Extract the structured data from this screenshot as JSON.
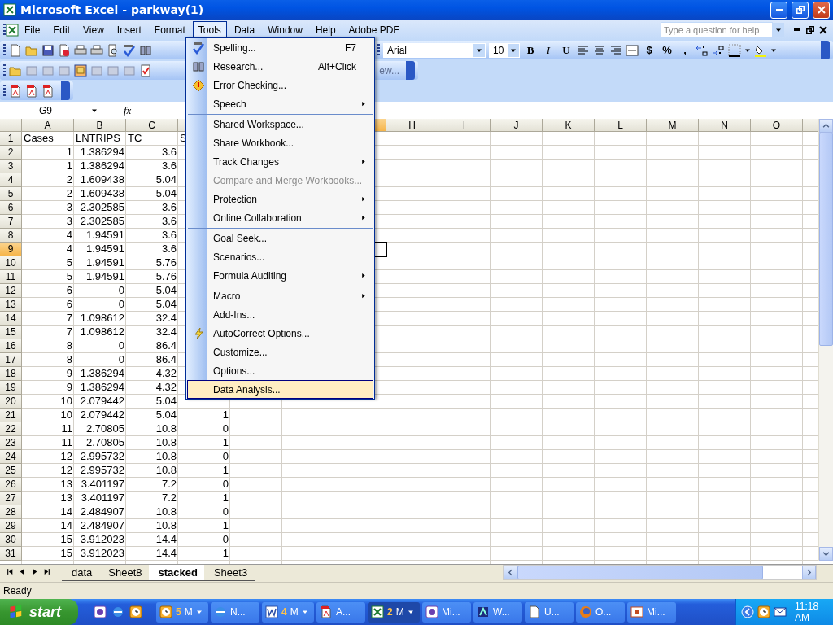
{
  "window": {
    "title": "Microsoft Excel - parkway(1)"
  },
  "menu_bar": [
    {
      "label": "File",
      "selected": false
    },
    {
      "label": "Edit",
      "selected": false
    },
    {
      "label": "View",
      "selected": false
    },
    {
      "label": "Insert",
      "selected": false
    },
    {
      "label": "Format",
      "selected": false
    },
    {
      "label": "Tools",
      "selected": true
    },
    {
      "label": "Data",
      "selected": false
    },
    {
      "label": "Window",
      "selected": false
    },
    {
      "label": "Help",
      "selected": false
    },
    {
      "label": "Adobe PDF",
      "selected": false
    }
  ],
  "help_box": {
    "placeholder": "Type a question for help"
  },
  "formatting_toolbar": {
    "font": "Arial",
    "size": "10",
    "style_buttons": [
      "B",
      "I",
      "U"
    ],
    "number_buttons": [
      "$",
      "%",
      ","
    ]
  },
  "reviewing_toolbar": {
    "button": "ew..."
  },
  "formula_bar": {
    "name_box": "G9",
    "function_label": "fx"
  },
  "sheet": {
    "columns": [
      {
        "label": "A",
        "selected": false
      },
      {
        "label": "B",
        "selected": false
      },
      {
        "label": "C",
        "selected": false
      },
      {
        "selected": false
      }
    ],
    "columns_right": [
      {
        "selected": true
      },
      {
        "label": "H",
        "selected": false
      },
      {
        "label": "I",
        "selected": false
      },
      {
        "label": "J",
        "selected": false
      },
      {
        "label": "K",
        "selected": false
      },
      {
        "label": "L",
        "selected": false
      },
      {
        "label": "M",
        "selected": false
      },
      {
        "label": "N",
        "selected": false
      },
      {
        "label": "O",
        "selected": false
      }
    ],
    "rows": [
      {
        "number": "1",
        "selected": false,
        "kind": "labels",
        "cells": [
          "Cases",
          "LNTRIPS",
          "TC",
          "S"
        ]
      },
      {
        "number": "2",
        "selected": false,
        "kind": "values",
        "cells": [
          "1",
          "1.386294",
          "3.6"
        ]
      },
      {
        "number": "3",
        "selected": false,
        "kind": "values",
        "cells": [
          "1",
          "1.386294",
          "3.6"
        ]
      },
      {
        "number": "4",
        "selected": false,
        "kind": "values",
        "cells": [
          "2",
          "1.609438",
          "5.04"
        ]
      },
      {
        "number": "5",
        "selected": false,
        "kind": "values",
        "cells": [
          "2",
          "1.609438",
          "5.04"
        ]
      },
      {
        "number": "6",
        "selected": false,
        "kind": "values",
        "cells": [
          "3",
          "2.302585",
          "3.6"
        ]
      },
      {
        "number": "7",
        "selected": false,
        "kind": "values",
        "cells": [
          "3",
          "2.302585",
          "3.6"
        ]
      },
      {
        "number": "8",
        "selected": false,
        "kind": "values",
        "cells": [
          "4",
          "1.94591",
          "3.6"
        ]
      },
      {
        "number": "9",
        "selected": true,
        "kind": "values",
        "cells": [
          "4",
          "1.94591",
          "3.6"
        ]
      },
      {
        "number": "10",
        "selected": false,
        "kind": "values",
        "cells": [
          "5",
          "1.94591",
          "5.76"
        ]
      },
      {
        "number": "11",
        "selected": false,
        "kind": "values",
        "cells": [
          "5",
          "1.94591",
          "5.76"
        ]
      },
      {
        "number": "12",
        "selected": false,
        "kind": "values",
        "cells": [
          "6",
          "0",
          "5.04"
        ]
      },
      {
        "number": "13",
        "selected": false,
        "kind": "values",
        "cells": [
          "6",
          "0",
          "5.04"
        ]
      },
      {
        "number": "14",
        "selected": false,
        "kind": "values",
        "cells": [
          "7",
          "1.098612",
          "32.4"
        ]
      },
      {
        "number": "15",
        "selected": false,
        "kind": "values",
        "cells": [
          "7",
          "1.098612",
          "32.4"
        ]
      },
      {
        "number": "16",
        "selected": false,
        "kind": "values",
        "cells": [
          "8",
          "0",
          "86.4"
        ]
      },
      {
        "number": "17",
        "selected": false,
        "kind": "values",
        "cells": [
          "8",
          "0",
          "86.4"
        ]
      },
      {
        "number": "18",
        "selected": false,
        "kind": "values",
        "cells": [
          "9",
          "1.386294",
          "4.32"
        ]
      },
      {
        "number": "19",
        "selected": false,
        "kind": "values",
        "cells": [
          "9",
          "1.386294",
          "4.32"
        ]
      },
      {
        "number": "20",
        "selected": false,
        "kind": "values",
        "cells": [
          "10",
          "2.079442",
          "5.04"
        ]
      },
      {
        "number": "21",
        "selected": false,
        "kind": "values",
        "cells": [
          "10",
          "2.079442",
          "5.04",
          "1"
        ]
      },
      {
        "number": "22",
        "selected": false,
        "kind": "values",
        "cells": [
          "11",
          "2.70805",
          "10.8",
          "0"
        ]
      },
      {
        "number": "23",
        "selected": false,
        "kind": "values",
        "cells": [
          "11",
          "2.70805",
          "10.8",
          "1"
        ]
      },
      {
        "number": "24",
        "selected": false,
        "kind": "values",
        "cells": [
          "12",
          "2.995732",
          "10.8",
          "0"
        ]
      },
      {
        "number": "25",
        "selected": false,
        "kind": "values",
        "cells": [
          "12",
          "2.995732",
          "10.8",
          "1"
        ]
      },
      {
        "number": "26",
        "selected": false,
        "kind": "values",
        "cells": [
          "13",
          "3.401197",
          "7.2",
          "0"
        ]
      },
      {
        "number": "27",
        "selected": false,
        "kind": "values",
        "cells": [
          "13",
          "3.401197",
          "7.2",
          "1"
        ]
      },
      {
        "number": "28",
        "selected": false,
        "kind": "values",
        "cells": [
          "14",
          "2.484907",
          "10.8",
          "0"
        ]
      },
      {
        "number": "29",
        "selected": false,
        "kind": "values",
        "cells": [
          "14",
          "2.484907",
          "10.8",
          "1"
        ]
      },
      {
        "number": "30",
        "selected": false,
        "kind": "values",
        "cells": [
          "15",
          "3.912023",
          "14.4",
          "0"
        ]
      },
      {
        "number": "31",
        "selected": false,
        "kind": "values",
        "cells": [
          "15",
          "3.912023",
          "14.4",
          "1"
        ]
      }
    ]
  },
  "tools_menu": {
    "items": [
      {
        "label": "Spelling...",
        "shortcut": "F7",
        "kind": "spelling",
        "submenu": false,
        "disabled": false,
        "separator_before": false,
        "selected": false
      },
      {
        "label": "Research...",
        "shortcut": "Alt+Click",
        "kind": "research",
        "submenu": false,
        "disabled": false,
        "separator_before": false,
        "selected": false
      },
      {
        "label": "Error Checking...",
        "kind": "error-check",
        "submenu": false,
        "disabled": false,
        "separator_before": false,
        "selected": false
      },
      {
        "label": "Speech",
        "kind": "plain",
        "submenu": true,
        "disabled": false,
        "separator_before": false,
        "selected": false
      },
      {
        "label": "Shared Workspace...",
        "kind": "plain",
        "submenu": false,
        "disabled": false,
        "separator_before": true,
        "selected": false
      },
      {
        "label": "Share Workbook...",
        "kind": "plain",
        "submenu": false,
        "disabled": false,
        "separator_before": false,
        "selected": false
      },
      {
        "label": "Track Changes",
        "kind": "plain",
        "submenu": true,
        "disabled": false,
        "separator_before": false,
        "selected": false
      },
      {
        "label": "Compare and Merge Workbooks...",
        "kind": "plain",
        "submenu": false,
        "disabled": true,
        "separator_before": false,
        "selected": false
      },
      {
        "label": "Protection",
        "kind": "plain",
        "submenu": true,
        "disabled": false,
        "separator_before": false,
        "selected": false
      },
      {
        "label": "Online Collaboration",
        "kind": "plain",
        "submenu": true,
        "disabled": false,
        "separator_before": false,
        "selected": false
      },
      {
        "label": "Goal Seek...",
        "kind": "plain",
        "submenu": false,
        "disabled": false,
        "separator_before": true,
        "selected": false
      },
      {
        "label": "Scenarios...",
        "kind": "plain",
        "submenu": false,
        "disabled": false,
        "separator_before": false,
        "selected": false
      },
      {
        "label": "Formula Auditing",
        "kind": "plain",
        "submenu": true,
        "disabled": false,
        "separator_before": false,
        "selected": false
      },
      {
        "label": "Macro",
        "kind": "plain",
        "submenu": true,
        "disabled": false,
        "separator_before": true,
        "selected": false
      },
      {
        "label": "Add-Ins...",
        "kind": "plain",
        "submenu": false,
        "disabled": false,
        "separator_before": false,
        "selected": false
      },
      {
        "label": "AutoCorrect Options...",
        "kind": "autocorrect",
        "submenu": false,
        "disabled": false,
        "separator_before": false,
        "selected": false
      },
      {
        "label": "Customize...",
        "kind": "plain",
        "submenu": false,
        "disabled": false,
        "separator_before": false,
        "selected": false
      },
      {
        "label": "Options...",
        "kind": "plain",
        "submenu": false,
        "disabled": false,
        "separator_before": false,
        "selected": false
      },
      {
        "label": "Data Analysis...",
        "kind": "plain",
        "submenu": false,
        "disabled": false,
        "separator_before": false,
        "selected": true
      }
    ]
  },
  "sheet_tabs": [
    {
      "label": "data",
      "selected": false
    },
    {
      "label": "Sheet8",
      "selected": false
    },
    {
      "label": "stacked",
      "selected": true
    },
    {
      "label": "Sheet3",
      "selected": false
    }
  ],
  "status_bar": {
    "text": "Ready"
  },
  "taskbar": {
    "start": "start",
    "buttons": [
      {
        "count": "5",
        "label": "M",
        "kind": "clock",
        "group": true,
        "selected": false
      },
      {
        "label": "N...",
        "kind": "browser",
        "group": false,
        "selected": false
      },
      {
        "count": "4",
        "label": "M",
        "kind": "word",
        "group": true,
        "selected": false
      },
      {
        "label": "A...",
        "kind": "pdf",
        "group": false,
        "selected": false
      },
      {
        "count": "2",
        "label": "M",
        "kind": "excel",
        "group": true,
        "selected": true
      },
      {
        "label": "Mi...",
        "kind": "app",
        "group": false,
        "selected": false
      },
      {
        "label": "W...",
        "kind": "ftp",
        "group": false,
        "selected": false
      },
      {
        "label": "U...",
        "kind": "doc",
        "group": false,
        "selected": false
      },
      {
        "label": "O...",
        "kind": "firefox",
        "group": false,
        "selected": false
      },
      {
        "label": "Mi...",
        "kind": "slides",
        "group": false,
        "selected": false
      }
    ],
    "clock": "11:18 AM"
  }
}
